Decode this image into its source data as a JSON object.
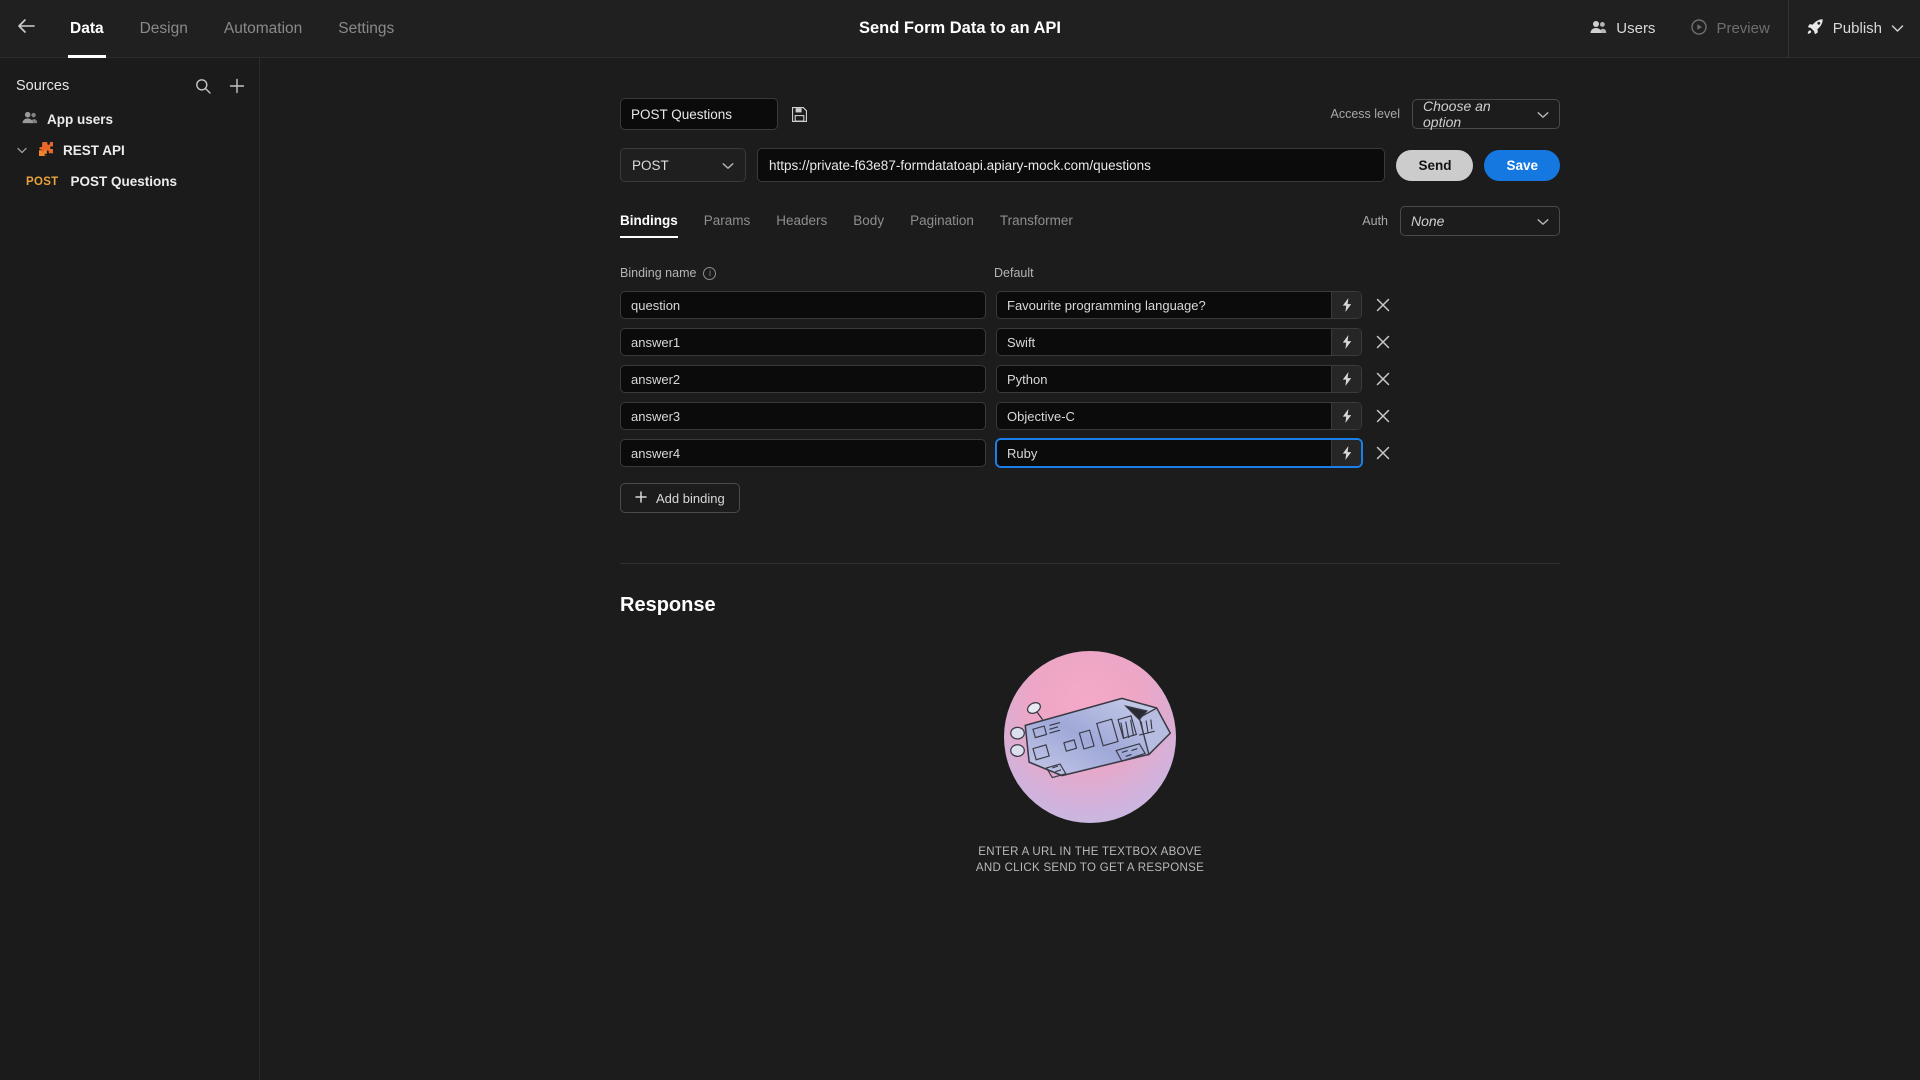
{
  "header": {
    "back_icon": "arrow-left-icon",
    "title": "Send Form Data to an API",
    "nav_tabs": [
      {
        "label": "Data",
        "active": true
      },
      {
        "label": "Design",
        "active": false
      },
      {
        "label": "Automation",
        "active": false
      },
      {
        "label": "Settings",
        "active": false
      }
    ],
    "users_label": "Users",
    "users_icon": "users-icon",
    "preview_label": "Preview",
    "preview_icon": "play-circle-icon",
    "publish_label": "Publish",
    "publish_icon": "rocket-icon",
    "publish_chevron": "chevron-down-icon"
  },
  "sidebar": {
    "title": "Sources",
    "search_icon": "search-icon",
    "add_icon": "plus-icon",
    "items": [
      {
        "label": "App users",
        "icon": "users-icon"
      },
      {
        "label": "REST API",
        "icon": "puzzle-icon",
        "expanded": true
      }
    ],
    "rest_api_children": [
      {
        "method": "POST",
        "label": "POST Questions"
      }
    ]
  },
  "query": {
    "name_value": "POST Questions",
    "save_icon": "floppy-disk-icon",
    "access_level_label": "Access level",
    "access_level_value": "Choose an option",
    "method_value": "POST",
    "url_value": "https://private-f63e87-formdatatoapi.apiary-mock.com/questions",
    "send_label": "Send",
    "save_label": "Save",
    "auth_label": "Auth",
    "auth_value": "None",
    "tabs": [
      {
        "label": "Bindings",
        "active": true
      },
      {
        "label": "Params",
        "active": false
      },
      {
        "label": "Headers",
        "active": false
      },
      {
        "label": "Body",
        "active": false
      },
      {
        "label": "Pagination",
        "active": false
      },
      {
        "label": "Transformer",
        "active": false
      }
    ]
  },
  "bindings": {
    "col_name_header": "Binding name",
    "col_default_header": "Default",
    "info_icon": "info-icon",
    "bolt_icon": "lightning-bolt-icon",
    "remove_icon": "close-icon",
    "add_label": "Add binding",
    "add_icon": "plus-icon",
    "rows": [
      {
        "name": "question",
        "value": "Favourite programming language?",
        "focused": false
      },
      {
        "name": "answer1",
        "value": "Swift",
        "focused": false
      },
      {
        "name": "answer2",
        "value": "Python",
        "focused": false
      },
      {
        "name": "answer3",
        "value": "Objective-C",
        "focused": false
      },
      {
        "name": "answer4",
        "value": "Ruby",
        "focused": true
      }
    ]
  },
  "response": {
    "title": "Response",
    "empty_illustration": "spaceship-illustration",
    "empty_line1": "ENTER A URL IN THE TEXTBOX ABOVE",
    "empty_line2": "AND CLICK SEND TO GET A RESPONSE"
  },
  "colors": {
    "accent_blue": "#1478e0",
    "method_orange": "#e8a33d",
    "send_gray": "#cccccc"
  }
}
